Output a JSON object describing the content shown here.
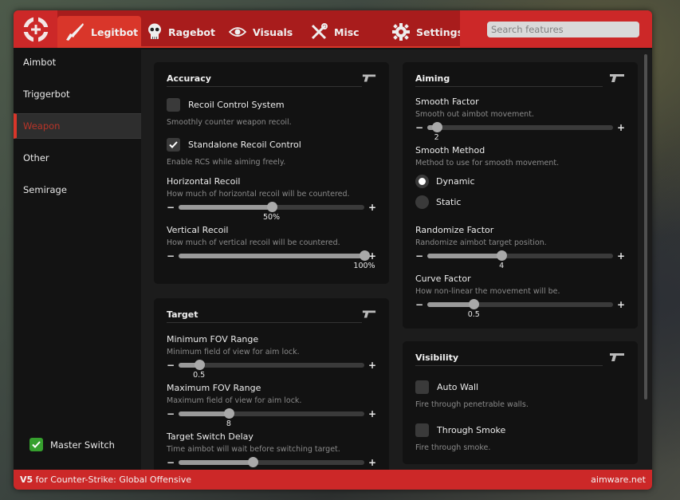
{
  "app": {
    "footer_version": "V5",
    "footer_text": "for Counter-Strike: Global Offensive",
    "footer_site": "aimware.net"
  },
  "tabs": [
    {
      "label": "Legitbot",
      "icon": "rifle-icon",
      "active": true
    },
    {
      "label": "Ragebot",
      "icon": "skull-icon",
      "active": false
    },
    {
      "label": "Visuals",
      "icon": "eye-icon",
      "active": false
    },
    {
      "label": "Misc",
      "icon": "tools-icon",
      "active": false
    },
    {
      "label": "Settings",
      "icon": "gear-icon",
      "active": false
    }
  ],
  "search": {
    "placeholder": "Search features",
    "value": ""
  },
  "sidebar": {
    "items": [
      {
        "label": "Aimbot",
        "active": false
      },
      {
        "label": "Triggerbot",
        "active": false
      },
      {
        "label": "Weapon",
        "active": true
      },
      {
        "label": "Other",
        "active": false
      },
      {
        "label": "Semirage",
        "active": false
      }
    ],
    "master_switch": {
      "label": "Master Switch",
      "checked": true
    }
  },
  "colors": {
    "accent": "#cc2828",
    "active_tab": "#d9362a",
    "checkbox_on": "#36a02e"
  },
  "groups": {
    "accuracy": {
      "title": "Accuracy",
      "icon": "pistol-icon",
      "rcs": {
        "label": "Recoil Control System",
        "desc": "Smoothly counter weapon recoil.",
        "checked": false
      },
      "standalone": {
        "label": "Standalone Recoil Control",
        "desc": "Enable RCS while aiming freely.",
        "checked": true
      },
      "horizontal": {
        "label": "Horizontal Recoil",
        "desc": "How much of horizontal recoil will be countered.",
        "value": "50%",
        "fraction": 0.5
      },
      "vertical": {
        "label": "Vertical Recoil",
        "desc": "How much of vertical recoil will be countered.",
        "value": "100%",
        "fraction": 1.0
      }
    },
    "target": {
      "title": "Target",
      "icon": "pistol-icon",
      "min_fov": {
        "label": "Minimum FOV Range",
        "desc": "Minimum field of view for aim lock.",
        "value": "0.5",
        "fraction": 0.11
      },
      "max_fov": {
        "label": "Maximum FOV Range",
        "desc": "Maximum field of view for aim lock.",
        "value": "8",
        "fraction": 0.27
      },
      "switch_delay": {
        "label": "Target Switch Delay",
        "desc": "Time aimbot will wait before switching target.",
        "value": "",
        "fraction": 0.4
      }
    },
    "aiming": {
      "title": "Aiming",
      "icon": "pistol-icon",
      "smooth_factor": {
        "label": "Smooth Factor",
        "desc": "Smooth out aimbot movement.",
        "value": "2",
        "fraction": 0.05
      },
      "smooth_method": {
        "label": "Smooth Method",
        "desc": "Method to use for smooth movement.",
        "options": [
          "Dynamic",
          "Static"
        ],
        "selected": "Dynamic"
      },
      "randomize": {
        "label": "Randomize Factor",
        "desc": "Randomize aimbot target position.",
        "value": "4",
        "fraction": 0.4
      },
      "curve": {
        "label": "Curve Factor",
        "desc": "How non-linear the movement will be.",
        "value": "0.5",
        "fraction": 0.25
      }
    },
    "visibility": {
      "title": "Visibility",
      "icon": "pistol-icon",
      "autowall": {
        "label": "Auto Wall",
        "desc": "Fire through penetrable walls.",
        "checked": false
      },
      "smoke": {
        "label": "Through Smoke",
        "desc": "Fire through smoke.",
        "checked": false
      }
    }
  }
}
